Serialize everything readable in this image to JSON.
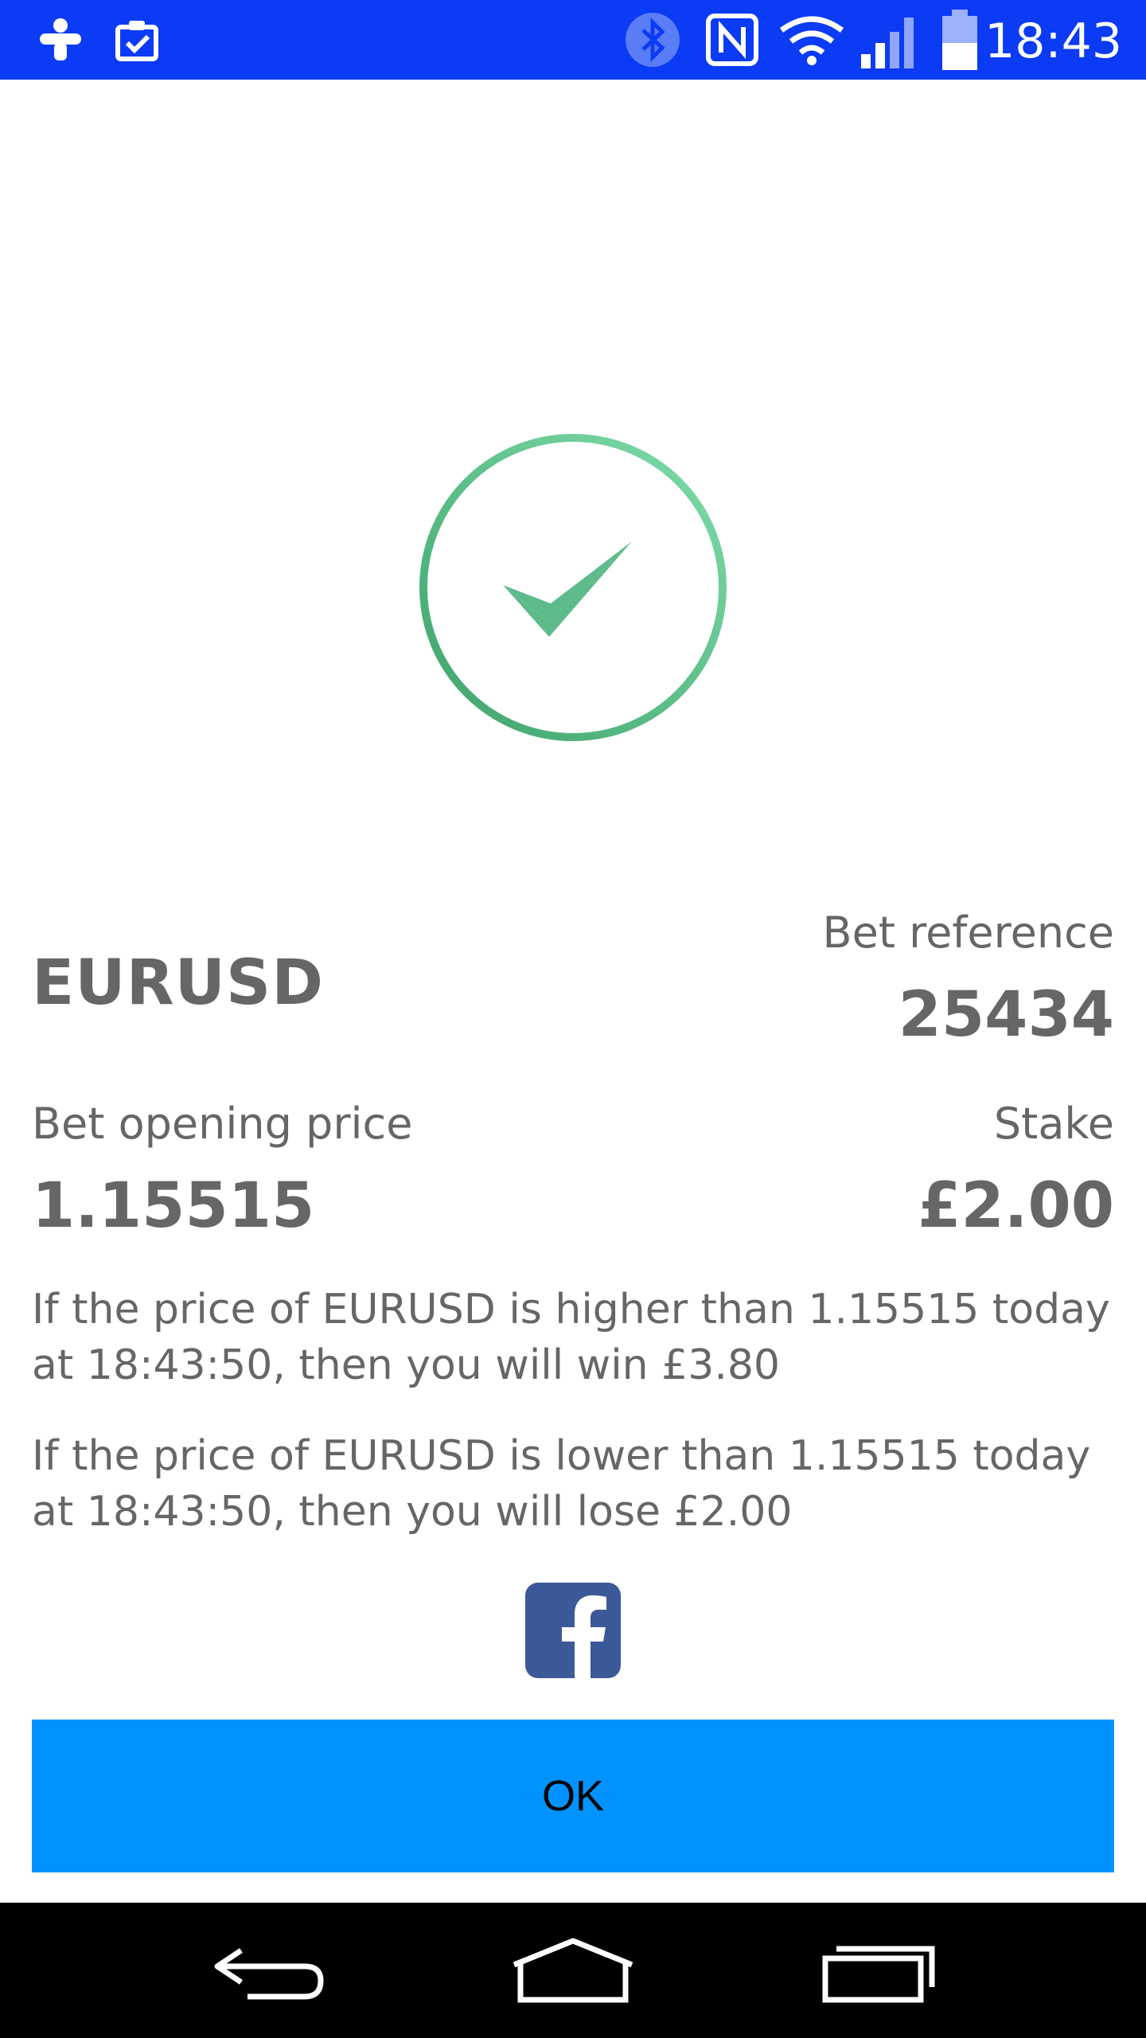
{
  "status_bar": {
    "time": "18:43",
    "icons": [
      "tripadvisor-icon",
      "clipboard-check-icon",
      "bluetooth-icon",
      "nfc-icon",
      "wifi-icon",
      "signal-icon",
      "battery-icon"
    ]
  },
  "confirmation": {
    "icon": "check-circle-icon",
    "accent_color": "#5dbb8a"
  },
  "bet": {
    "symbol": "EURUSD",
    "reference_label": "Bet reference",
    "reference_value": "25434",
    "opening_price_label": "Bet opening price",
    "opening_price_value": "1.15515",
    "stake_label": "Stake",
    "stake_value": "£2.00",
    "win_text": "If the price of EURUSD is higher than 1.15515 today at 18:43:50, then you will win £3.80",
    "lose_text": "If the price of EURUSD is lower than 1.15515 today at 18:43:50, then you will lose £2.00"
  },
  "share": {
    "icon": "facebook-icon",
    "color": "#3b5998"
  },
  "actions": {
    "ok_label": "OK",
    "ok_color": "#0093ff"
  },
  "nav_bar": {
    "icons": [
      "back-icon",
      "home-icon",
      "recents-icon"
    ]
  }
}
